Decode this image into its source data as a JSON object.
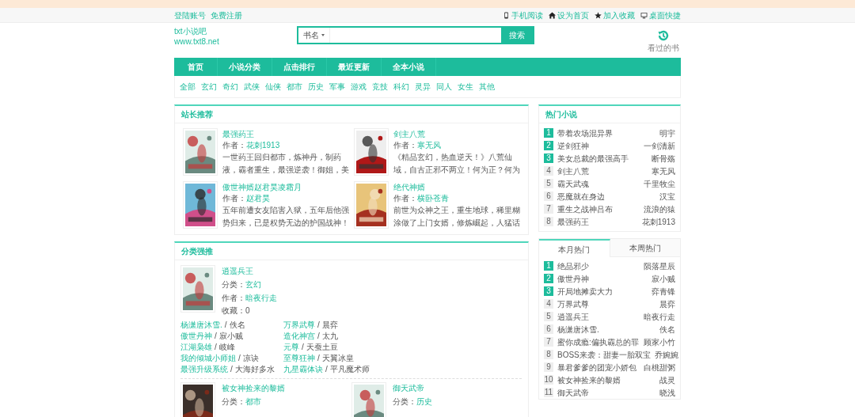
{
  "top_bar": {
    "left_links": [
      "登陆账号",
      "免费注册"
    ],
    "right_links": [
      "手机阅读",
      "设为首页",
      "加入收藏",
      "桌面快捷"
    ]
  },
  "logo": {
    "name": "txt小说吧",
    "url": "www.txt8.net"
  },
  "search": {
    "scope": "书名",
    "button": "搜索"
  },
  "history": {
    "label": "看过的书"
  },
  "nav": [
    "首页",
    "小说分类",
    "点击排行",
    "最近更新",
    "全本小说"
  ],
  "categories": [
    "全部",
    "玄幻",
    "奇幻",
    "武侠",
    "仙侠",
    "都市",
    "历史",
    "军事",
    "游戏",
    "竞技",
    "科幻",
    "灵异",
    "同人",
    "女生",
    "其他"
  ],
  "recommend": {
    "title": "站长推荐",
    "books": [
      {
        "title": "最强药王",
        "author_label": "作者：",
        "author": "花刺1913",
        "intro": "一世药王回归都市，炼神丹，制药液，霸者重生，最强逆袭！御姐，美"
      },
      {
        "title": "剑主八荒",
        "author_label": "作者：",
        "author": "寒无风",
        "intro": "《精品玄幻，热血逆天！》八荒仙域，自古正邪不两立！何为正？何为"
      },
      {
        "title": "傲世神婿赵君昊凌霜月",
        "author_label": "作者：",
        "author": "赵君昊",
        "intro": "五年前遭女友陷害入狱，五年后他强势归来，已是权势无边的护国战神！"
      },
      {
        "title": "绝代神婿",
        "author_label": "作者：",
        "author": "横卧苍青",
        "intro": "前世为众神之王，重生地球，稀里糊涂做了上门女婿，修炼崛起，人猛话"
      }
    ]
  },
  "hot": {
    "title": "热门小说",
    "items": [
      {
        "rank": "1",
        "top": true,
        "title": "带着农场混异界",
        "author": "明宇"
      },
      {
        "rank": "2",
        "top": true,
        "title": "逆剑狂神",
        "author": "一剑清新"
      },
      {
        "rank": "3",
        "top": true,
        "title": "美女总裁的最强高手",
        "author": "断骨殇"
      },
      {
        "rank": "4",
        "top": false,
        "title": "剑主八荒",
        "author": "寒无风"
      },
      {
        "rank": "5",
        "top": false,
        "title": "霸天武魂",
        "author": "千里牧尘"
      },
      {
        "rank": "6",
        "top": false,
        "title": "恶魔就在身边",
        "author": "汉宝"
      },
      {
        "rank": "7",
        "top": false,
        "title": "重生之战神吕布",
        "author": "流浪的猿"
      },
      {
        "rank": "8",
        "top": false,
        "title": "最强药王",
        "author": "花刺1913"
      }
    ]
  },
  "category_picks": {
    "title": "分类强推",
    "featured": {
      "title": "逍遥兵王",
      "category_label": "分类：",
      "category": "玄幻",
      "author_label": "作者：",
      "author": "暗夜行走",
      "favorites": "收藏：0"
    },
    "links": [
      {
        "title": "杨潇唐沐雪.",
        "separator": "/",
        "author": "佚名"
      },
      {
        "title": "万界武尊",
        "separator": "/",
        "author": "晨弈"
      },
      {
        "title": "傲世丹神",
        "separator": "/",
        "author": "寂小贼"
      },
      {
        "title": "造化神宫",
        "separator": "/",
        "author": "太九"
      },
      {
        "title": "江湖枭雄",
        "separator": "/",
        "author": "岐峰"
      },
      {
        "title": "元尊",
        "separator": "/",
        "author": "天蚕土豆"
      },
      {
        "title": "我的倾城小师姐",
        "separator": "/",
        "author": "凉诀"
      },
      {
        "title": "至尊狂神",
        "separator": "/",
        "author": "天翼冰皇"
      },
      {
        "title": "最强升级系统",
        "separator": "/",
        "author": "大海好多水"
      },
      {
        "title": "九星霸体诀",
        "separator": "/",
        "author": "平凡魔术师"
      }
    ],
    "more": [
      {
        "title": "被女神捡来的黎婿",
        "category_label": "分类：",
        "category": "都市"
      },
      {
        "title": "御天武帝",
        "category_label": "分类：",
        "category": "历史"
      }
    ]
  },
  "ranking": {
    "tabs": [
      {
        "label": "本月热门",
        "selected": true
      },
      {
        "label": "本周热门",
        "selected": false
      }
    ],
    "items": [
      {
        "rank": "1",
        "top": true,
        "title": "绝品邪少",
        "author": "陨落星辰"
      },
      {
        "rank": "2",
        "top": true,
        "title": "傲世丹神",
        "author": "寂小贼"
      },
      {
        "rank": "3",
        "top": true,
        "title": "开局地摊卖大力",
        "author": "弈青锋"
      },
      {
        "rank": "4",
        "top": false,
        "title": "万界武尊",
        "author": "晨弈"
      },
      {
        "rank": "5",
        "top": false,
        "title": "逍遥兵王",
        "author": "暗夜行走"
      },
      {
        "rank": "6",
        "top": false,
        "title": "杨潇唐沐雪.",
        "author": "佚名"
      },
      {
        "rank": "7",
        "top": false,
        "title": "蜜你成瘾:偏执霸总的罪",
        "author": "顾家小竹"
      },
      {
        "rank": "8",
        "top": false,
        "title": "BOSS来袭：甜妻一胎双宝",
        "author": "乔婉婉"
      },
      {
        "rank": "9",
        "top": false,
        "title": "暴君爹爹的团宠小娇包",
        "author": "白桃甜粥"
      },
      {
        "rank": "10",
        "top": false,
        "title": "被女神捡来的黎婿",
        "author": "战灵"
      },
      {
        "rank": "11",
        "top": false,
        "title": "御天武帝",
        "author": "晓浅"
      }
    ]
  }
}
